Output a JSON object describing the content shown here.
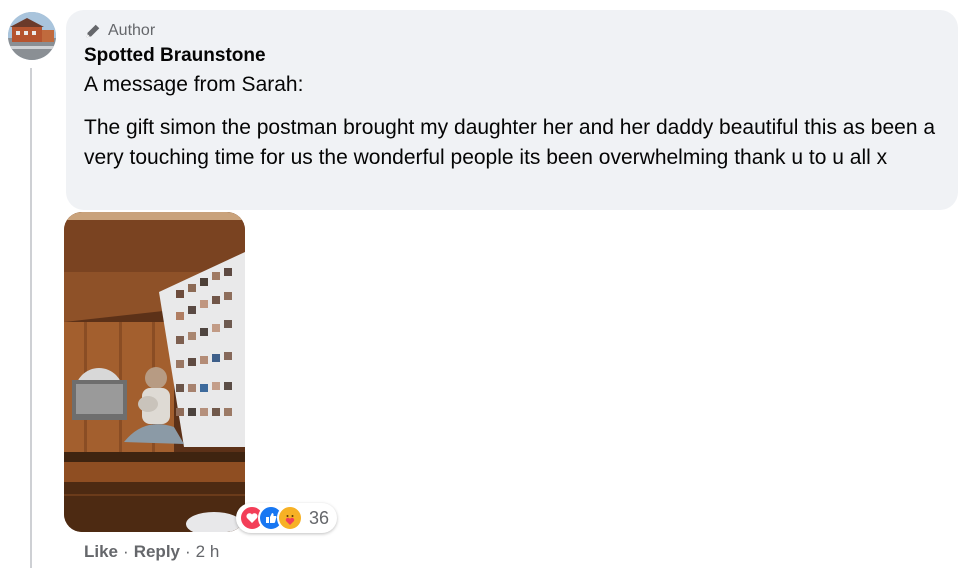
{
  "comment": {
    "badge_label": "Author",
    "author_name": "Spotted Braunstone",
    "line_1": "A message from Sarah:",
    "paragraph": "The gift simon the postman brought my daughter her and her daddy beautiful this as been a very touching time for us the wonderful people its been overwhelming thank u to u all x",
    "reactions": {
      "icons": [
        "heart-icon",
        "like-icon",
        "care-icon"
      ],
      "count": "36"
    },
    "actions": {
      "like_label": "Like",
      "separator": "·",
      "reply_label": "Reply",
      "time": "2 h"
    }
  },
  "colors": {
    "bubble_bg": "#f0f2f5",
    "secondary_text": "#65676b",
    "like_blue": "#1877f2",
    "heart_red": "#f33e58",
    "care_yellow": "#f7b125"
  }
}
